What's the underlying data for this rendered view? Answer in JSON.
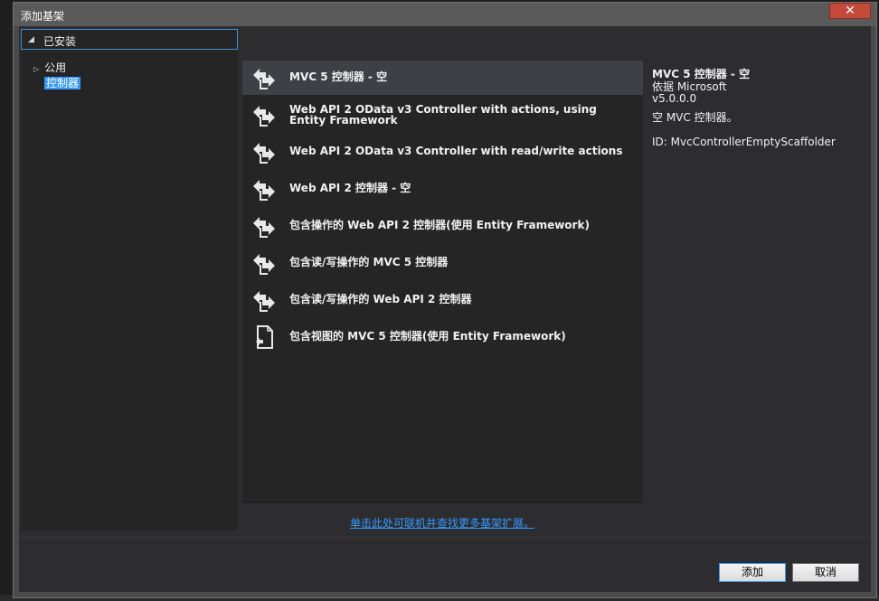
{
  "dialog": {
    "title": "添加基架",
    "close_glyph": "✕"
  },
  "tree": {
    "header": "已安装",
    "items": [
      {
        "label": "公用"
      },
      {
        "label": "控制器"
      }
    ]
  },
  "scaffolds": [
    {
      "name": "MVC 5 控制器 - 空"
    },
    {
      "name": "Web API 2 OData v3 Controller with actions, using Entity Framework"
    },
    {
      "name": "Web API 2 OData v3 Controller with read/write actions"
    },
    {
      "name": "Web API 2 控制器 - 空"
    },
    {
      "name": "包含操作的 Web API 2 控制器(使用 Entity Framework)"
    },
    {
      "name": "包含读/写操作的 MVC 5 控制器"
    },
    {
      "name": "包含读/写操作的 Web API 2 控制器"
    },
    {
      "name": "包含视图的 MVC 5 控制器(使用 Entity Framework)"
    }
  ],
  "details": {
    "title": "MVC 5 控制器 - 空",
    "author": "依据 Microsoft",
    "version": "v5.0.0.0",
    "description": "空 MVC 控制器。",
    "id": "ID: MvcControllerEmptyScaffolder"
  },
  "online_link": "单击此处可联机并查找更多基架扩展。",
  "buttons": {
    "add": "添加",
    "cancel": "取消"
  },
  "colors": {
    "accent": "#3399ff",
    "close": "#c44a3a"
  }
}
